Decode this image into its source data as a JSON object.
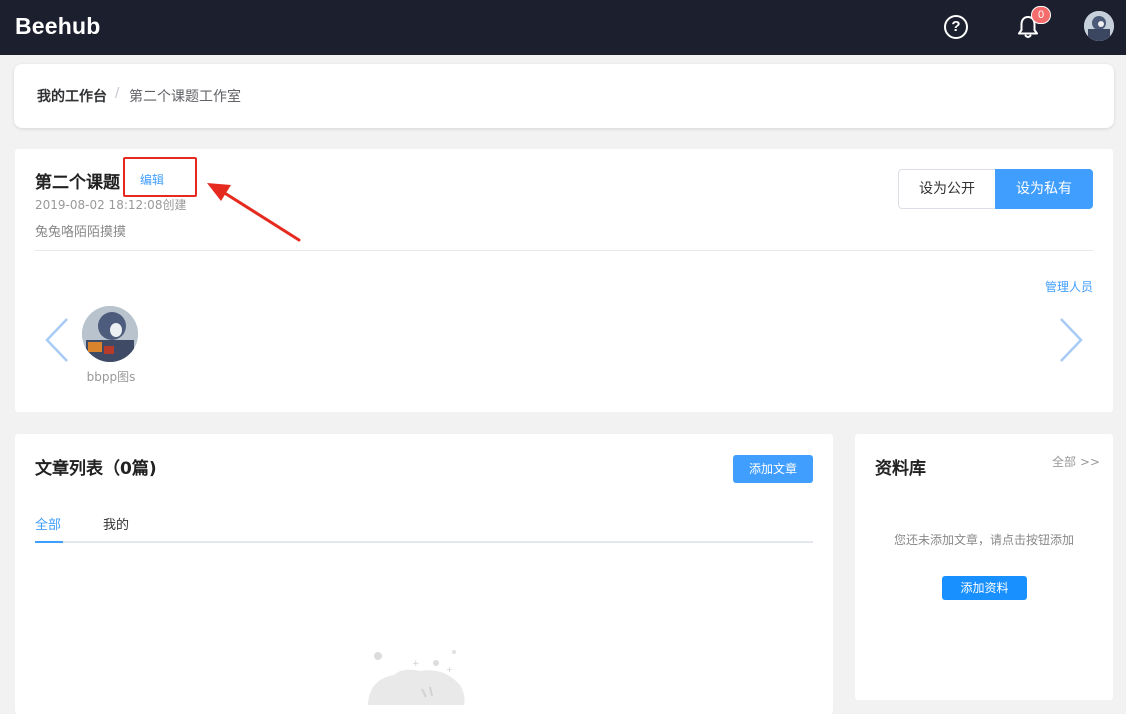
{
  "header": {
    "brand": "Beehub",
    "help_icon": "question-circle-icon",
    "bell_icon": "bell-icon",
    "notification_count": "0"
  },
  "breadcrumb": {
    "root": "我的工作台",
    "separator": "/",
    "current": "第二个课题工作室"
  },
  "project": {
    "title": "第二个课题",
    "edit_label": "编辑",
    "created": "2019-08-02 18:12:08创建",
    "description": "兔兔咯陌陌摸摸",
    "public_label": "设为公开",
    "private_label": "设为私有",
    "manage_label": "管理人员",
    "members": [
      {
        "name": "bbpp图s"
      }
    ]
  },
  "articles": {
    "title": "文章列表（0篇)",
    "add_label": "添加文章",
    "tabs": [
      {
        "label": "全部",
        "active": true
      },
      {
        "label": "我的",
        "active": false
      }
    ]
  },
  "library": {
    "title": "资料库",
    "all_label": "全部 >>",
    "empty_text": "您还未添加文章，请点击按钮添加",
    "add_label": "添加资料"
  },
  "colors": {
    "topbar": "#1c1f2d",
    "accent": "#409eff",
    "badge": "#f56c6c",
    "annotation": "#e52b20"
  }
}
